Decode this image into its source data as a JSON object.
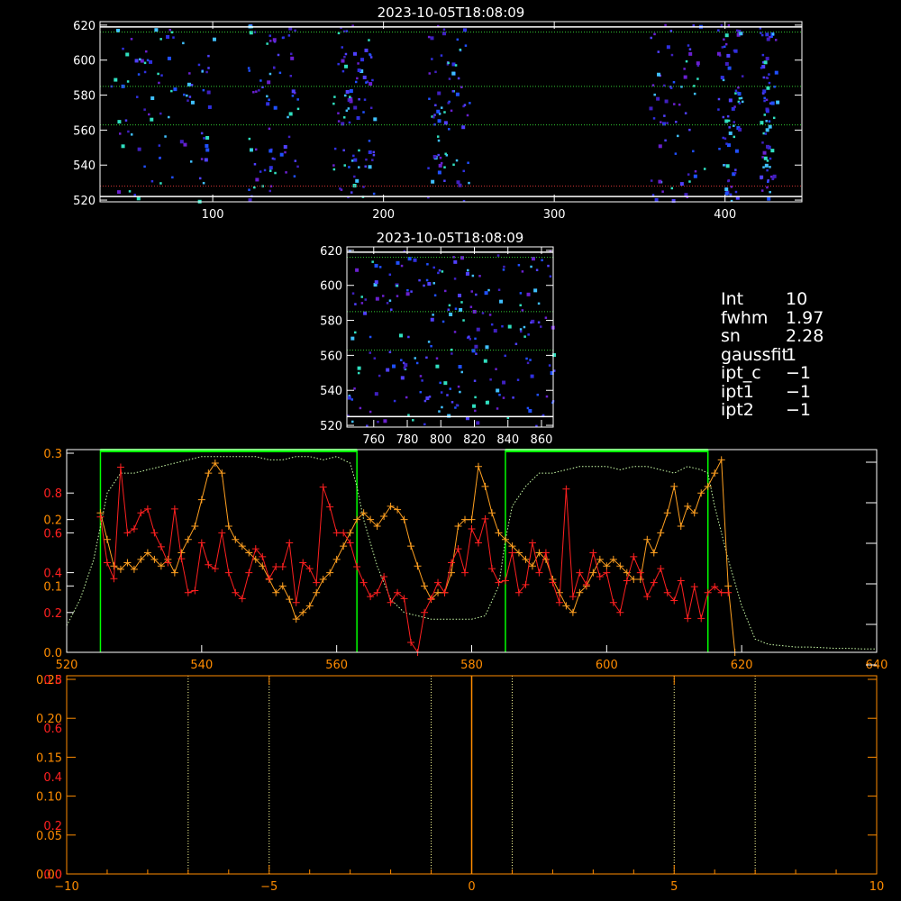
{
  "colors": {
    "background": "#000000",
    "axis": "#ffffff",
    "dotted_green": "#33cc33",
    "dotted_red": "#cc3333",
    "bright_green": "#00ff00",
    "series_red": "#ff2020",
    "series_orange": "#ffa020",
    "profile_dotted": "#ccffaa",
    "lower_axis": "#ff8c00",
    "lower_dotted": "#ffff99"
  },
  "info_panel": [
    {
      "key": "Int",
      "value": "10"
    },
    {
      "key": "fwhm",
      "value": "1.97"
    },
    {
      "key": "sn",
      "value": "2.28"
    },
    {
      "key": "gaussfit",
      "value": "1"
    },
    {
      "key": "ipt_c",
      "value": "−1"
    },
    {
      "key": "ipt1",
      "value": "−1"
    },
    {
      "key": "ipt2",
      "value": "−1"
    }
  ],
  "chart_data": [
    {
      "type": "heatmap",
      "title": "2023-10-05T18:08:09",
      "x_ticks": [
        "100",
        "200",
        "300",
        "400"
      ],
      "x_tick_values": [
        100,
        200,
        300,
        400
      ],
      "y_ticks": [
        "520",
        "540",
        "560",
        "580",
        "600",
        "620"
      ],
      "y_tick_values": [
        520,
        540,
        560,
        580,
        600,
        620
      ],
      "xlim": [
        34,
        445
      ],
      "ylim": [
        519,
        622
      ],
      "column_bands": [
        [
          40,
          100
        ],
        [
          120,
          150
        ],
        [
          170,
          195
        ],
        [
          225,
          250
        ],
        [
          355,
          390
        ],
        [
          395,
          410
        ],
        [
          420,
          430
        ]
      ],
      "green_dotted_y": [
        585,
        563,
        616
      ],
      "red_dotted_y": [
        528
      ],
      "white_lines_y": [
        619,
        522
      ],
      "seed": 7
    },
    {
      "type": "heatmap",
      "title": "2023-10-05T18:08:09",
      "x_ticks": [
        "760",
        "780",
        "800",
        "820",
        "840",
        "860"
      ],
      "x_tick_values": [
        760,
        780,
        800,
        820,
        840,
        860
      ],
      "y_ticks": [
        "520",
        "540",
        "560",
        "580",
        "600",
        "620"
      ],
      "y_tick_values": [
        520,
        540,
        560,
        580,
        600,
        620
      ],
      "xlim": [
        744,
        867
      ],
      "ylim": [
        519,
        622
      ],
      "green_dotted_y": [
        585,
        563,
        616
      ],
      "white_lines_y": [
        619,
        525
      ],
      "seed": 11
    },
    {
      "type": "line",
      "xlim": [
        520,
        640
      ],
      "x_ticks": [
        "520",
        "540",
        "560",
        "580",
        "600",
        "620",
        "640"
      ],
      "x_tick_values": [
        520,
        540,
        560,
        580,
        600,
        620,
        640
      ],
      "y_ticks_orange": [
        "0.0",
        "0.1",
        "0.2",
        "0.3"
      ],
      "y_ticks_orange_values": [
        0.0,
        0.1,
        0.2,
        0.3
      ],
      "y_ticks_red": [
        "0.2",
        "0.4",
        "0.6",
        "0.8"
      ],
      "y_ticks_red_values": [
        0.2,
        0.4,
        0.6,
        0.8
      ],
      "ylim_orange": [
        0.0,
        0.3
      ],
      "ylim_red": [
        0.0,
        1.0
      ],
      "green_boxes": [
        [
          525,
          563
        ],
        [
          585,
          615
        ]
      ],
      "series": [
        {
          "color": "#ff2020",
          "x": [
            525,
            526,
            527,
            528,
            529,
            530,
            531,
            532,
            533,
            534,
            535,
            536,
            537,
            538,
            539,
            540,
            541,
            542,
            543,
            544,
            545,
            546,
            547,
            548,
            549,
            550,
            551,
            552,
            553,
            554,
            555,
            556,
            557,
            558,
            559,
            560,
            561,
            562,
            563,
            564,
            565,
            566,
            567,
            568,
            569,
            570,
            571,
            572,
            573,
            574,
            575,
            576,
            577,
            578,
            579,
            580,
            581,
            582,
            583,
            584,
            585,
            586,
            587,
            588,
            589,
            590,
            591,
            592,
            593,
            594,
            595,
            596,
            597,
            598,
            599,
            600,
            601,
            602,
            603,
            604,
            605,
            606,
            607,
            608,
            609,
            610,
            611,
            612,
            613,
            614,
            615,
            616,
            617,
            618
          ],
          "y": [
            0.68,
            0.45,
            0.37,
            0.93,
            0.6,
            0.62,
            0.7,
            0.72,
            0.6,
            0.53,
            0.45,
            0.72,
            0.47,
            0.3,
            0.31,
            0.55,
            0.44,
            0.42,
            0.6,
            0.4,
            0.3,
            0.27,
            0.4,
            0.52,
            0.48,
            0.37,
            0.43,
            0.43,
            0.55,
            0.25,
            0.45,
            0.42,
            0.35,
            0.83,
            0.73,
            0.6,
            0.6,
            0.55,
            0.43,
            0.35,
            0.28,
            0.3,
            0.38,
            0.25,
            0.3,
            0.27,
            0.05,
            0.0,
            0.2,
            0.27,
            0.35,
            0.3,
            0.45,
            0.52,
            0.4,
            0.62,
            0.55,
            0.67,
            0.42,
            0.35,
            0.36,
            0.5,
            0.3,
            0.34,
            0.55,
            0.4,
            0.5,
            0.35,
            0.25,
            0.82,
            0.28,
            0.4,
            0.34,
            0.5,
            0.38,
            0.4,
            0.25,
            0.2,
            0.36,
            0.48,
            0.4,
            0.28,
            0.35,
            0.42,
            0.3,
            0.26,
            0.36,
            0.17,
            0.33,
            0.17,
            0.3,
            0.33,
            0.3,
            0.3
          ]
        },
        {
          "color": "#ffa020",
          "x": [
            525,
            526,
            527,
            528,
            529,
            530,
            531,
            532,
            533,
            534,
            535,
            536,
            537,
            538,
            539,
            540,
            541,
            542,
            543,
            544,
            545,
            546,
            547,
            548,
            549,
            550,
            551,
            552,
            553,
            554,
            555,
            556,
            557,
            558,
            559,
            560,
            561,
            562,
            563,
            564,
            565,
            566,
            567,
            568,
            569,
            570,
            571,
            572,
            573,
            574,
            575,
            576,
            577,
            578,
            579,
            580,
            581,
            582,
            583,
            584,
            585,
            586,
            587,
            588,
            589,
            590,
            591,
            592,
            593,
            594,
            595,
            596,
            597,
            598,
            599,
            600,
            601,
            602,
            603,
            604,
            605,
            606,
            607,
            608,
            609,
            610,
            611,
            612,
            613,
            614,
            615,
            616,
            617,
            618,
            619
          ],
          "y": [
            0.21,
            0.17,
            0.13,
            0.125,
            0.135,
            0.125,
            0.14,
            0.15,
            0.14,
            0.13,
            0.14,
            0.12,
            0.15,
            0.17,
            0.19,
            0.23,
            0.27,
            0.285,
            0.27,
            0.19,
            0.17,
            0.16,
            0.15,
            0.14,
            0.13,
            0.11,
            0.09,
            0.1,
            0.08,
            0.05,
            0.06,
            0.07,
            0.09,
            0.11,
            0.12,
            0.14,
            0.16,
            0.18,
            0.2,
            0.21,
            0.2,
            0.19,
            0.205,
            0.22,
            0.215,
            0.2,
            0.16,
            0.13,
            0.1,
            0.08,
            0.09,
            0.09,
            0.12,
            0.19,
            0.2,
            0.2,
            0.28,
            0.25,
            0.21,
            0.18,
            0.17,
            0.16,
            0.15,
            0.14,
            0.13,
            0.15,
            0.14,
            0.11,
            0.09,
            0.07,
            0.06,
            0.09,
            0.1,
            0.12,
            0.14,
            0.13,
            0.14,
            0.13,
            0.12,
            0.11,
            0.11,
            0.17,
            0.15,
            0.18,
            0.21,
            0.25,
            0.19,
            0.22,
            0.21,
            0.24,
            0.25,
            0.27,
            0.29,
            0.1,
            0.0
          ]
        },
        {
          "color": "#ccffaa",
          "x": [
            520,
            522,
            524,
            525,
            526,
            528,
            530,
            532,
            534,
            536,
            538,
            540,
            542,
            544,
            546,
            548,
            550,
            552,
            554,
            556,
            558,
            560,
            562,
            563,
            564,
            566,
            568,
            570,
            572,
            574,
            576,
            578,
            580,
            582,
            584,
            585,
            586,
            588,
            590,
            592,
            594,
            596,
            598,
            600,
            602,
            604,
            606,
            608,
            610,
            612,
            614,
            615,
            616,
            618,
            620,
            622,
            624,
            626,
            628,
            630,
            632,
            634,
            636,
            638,
            640
          ],
          "y": [
            0.04,
            0.08,
            0.14,
            0.19,
            0.24,
            0.27,
            0.27,
            0.275,
            0.28,
            0.285,
            0.29,
            0.295,
            0.295,
            0.295,
            0.295,
            0.295,
            0.29,
            0.29,
            0.295,
            0.295,
            0.29,
            0.295,
            0.285,
            0.25,
            0.2,
            0.13,
            0.08,
            0.06,
            0.055,
            0.05,
            0.05,
            0.05,
            0.05,
            0.055,
            0.1,
            0.17,
            0.22,
            0.25,
            0.27,
            0.27,
            0.275,
            0.28,
            0.28,
            0.28,
            0.275,
            0.28,
            0.28,
            0.275,
            0.27,
            0.28,
            0.275,
            0.27,
            0.22,
            0.14,
            0.07,
            0.02,
            0.012,
            0.01,
            0.008,
            0.008,
            0.007,
            0.006,
            0.006,
            0.005,
            0.005
          ]
        }
      ]
    },
    {
      "type": "line",
      "xlim": [
        -10,
        10
      ],
      "x_ticks": [
        "−10",
        "−5",
        "0",
        "5",
        "10"
      ],
      "x_tick_values": [
        -10,
        -5,
        0,
        5,
        10
      ],
      "y_ticks_orange": [
        "0.00",
        "0.05",
        "0.10",
        "0.15",
        "0.20",
        "0.25"
      ],
      "y_ticks_orange_values": [
        0.0,
        0.05,
        0.1,
        0.15,
        0.2,
        0.25
      ],
      "y_ticks_red": [
        "0.0",
        "0.2",
        "0.4",
        "0.6",
        "0.8"
      ],
      "y_ticks_red_values": [
        0.0,
        0.2,
        0.4,
        0.6,
        0.8
      ],
      "ylim_orange": [
        0.0,
        0.25
      ],
      "ylim_red": [
        0.0,
        0.8
      ],
      "vertical_dotted_x": [
        -7,
        -5,
        -1,
        1,
        5,
        7
      ],
      "vertical_solid_x": [
        0
      ]
    }
  ]
}
